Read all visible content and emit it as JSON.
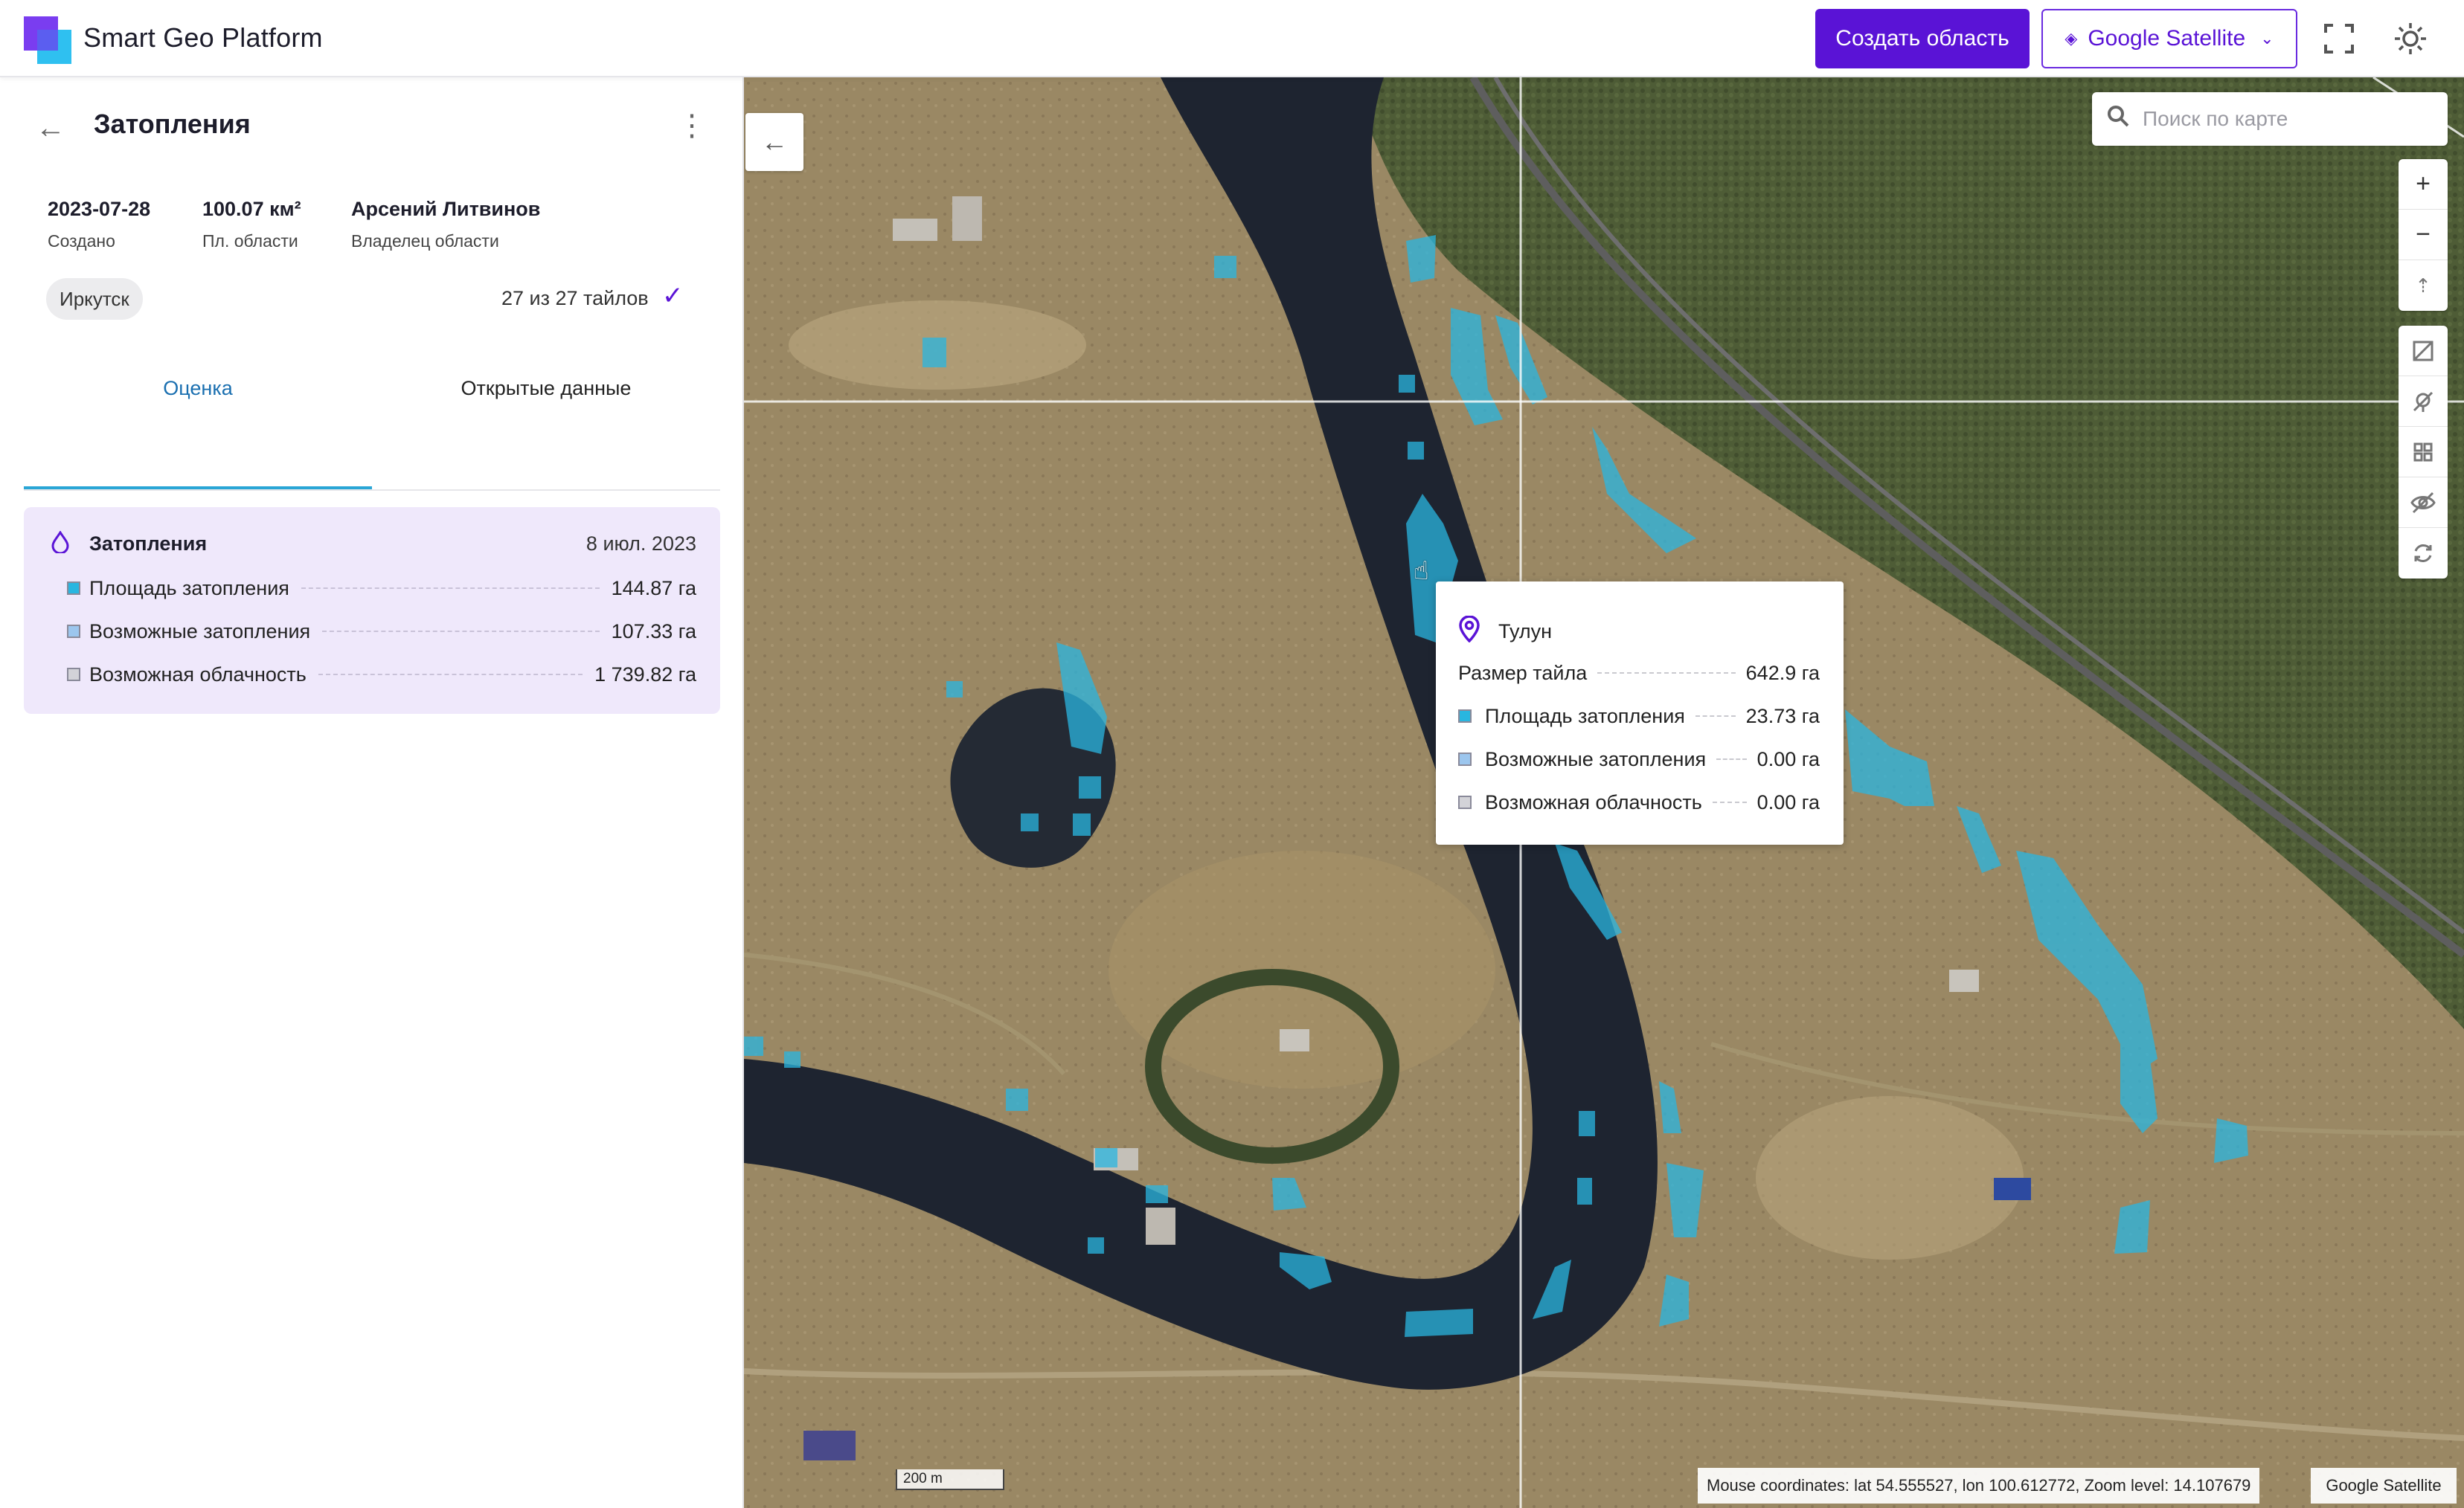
{
  "header": {
    "app_title": "Smart Geo Platform",
    "create_area_label": "Создать область",
    "layer_label": "Google Satellite",
    "icons": [
      "layers-icon",
      "chevron-down-icon",
      "fullscreen-icon",
      "theme-sun-icon"
    ]
  },
  "sidebar": {
    "title": "Затопления",
    "created_value": "2023-07-28",
    "created_label": "Создано",
    "area_value": "100.07 км²",
    "area_label": "Пл. области",
    "owner_value": "Арсений Литвинов",
    "owner_label": "Владелец области",
    "region_chip": "Иркутск",
    "tiles_status": "27 из 27 тайлов",
    "tabs": [
      {
        "label": "Оценка",
        "active": true
      },
      {
        "label": "Открытые данные",
        "active": false
      }
    ],
    "analysis": {
      "name": "Затопления",
      "date": "8 июл. 2023",
      "rows": [
        {
          "label": "Площадь затопления",
          "value": "144.87 га",
          "color": "#29b6e0"
        },
        {
          "label": "Возможные затопления",
          "value": "107.33 га",
          "color": "#9cc6ee"
        },
        {
          "label": "Возможная облачность",
          "value": "1 739.82 га",
          "color": "#d3d3d8"
        }
      ]
    }
  },
  "map": {
    "search_placeholder": "Поиск по карте",
    "scale_label": "200 m",
    "coords_text": "Mouse coordinates: lat 54.555527, lon 100.612772, Zoom level: 14.107679",
    "provider_label": "Google Satellite",
    "tooltip": {
      "place": "Тулун",
      "tile_size_label": "Размер тайла",
      "tile_size_value": "642.9 га",
      "rows": [
        {
          "label": "Площадь затопления",
          "value": "23.73 га",
          "color": "#29b6e0"
        },
        {
          "label": "Возможные затопления",
          "value": "0.00 га",
          "color": "#9cc6ee"
        },
        {
          "label": "Возможная облачность",
          "value": "0.00 га",
          "color": "#d3d3d8"
        }
      ]
    }
  },
  "colors": {
    "accent": "#5a13d6",
    "flood": "#29b6e0",
    "water": "#1e2430"
  }
}
